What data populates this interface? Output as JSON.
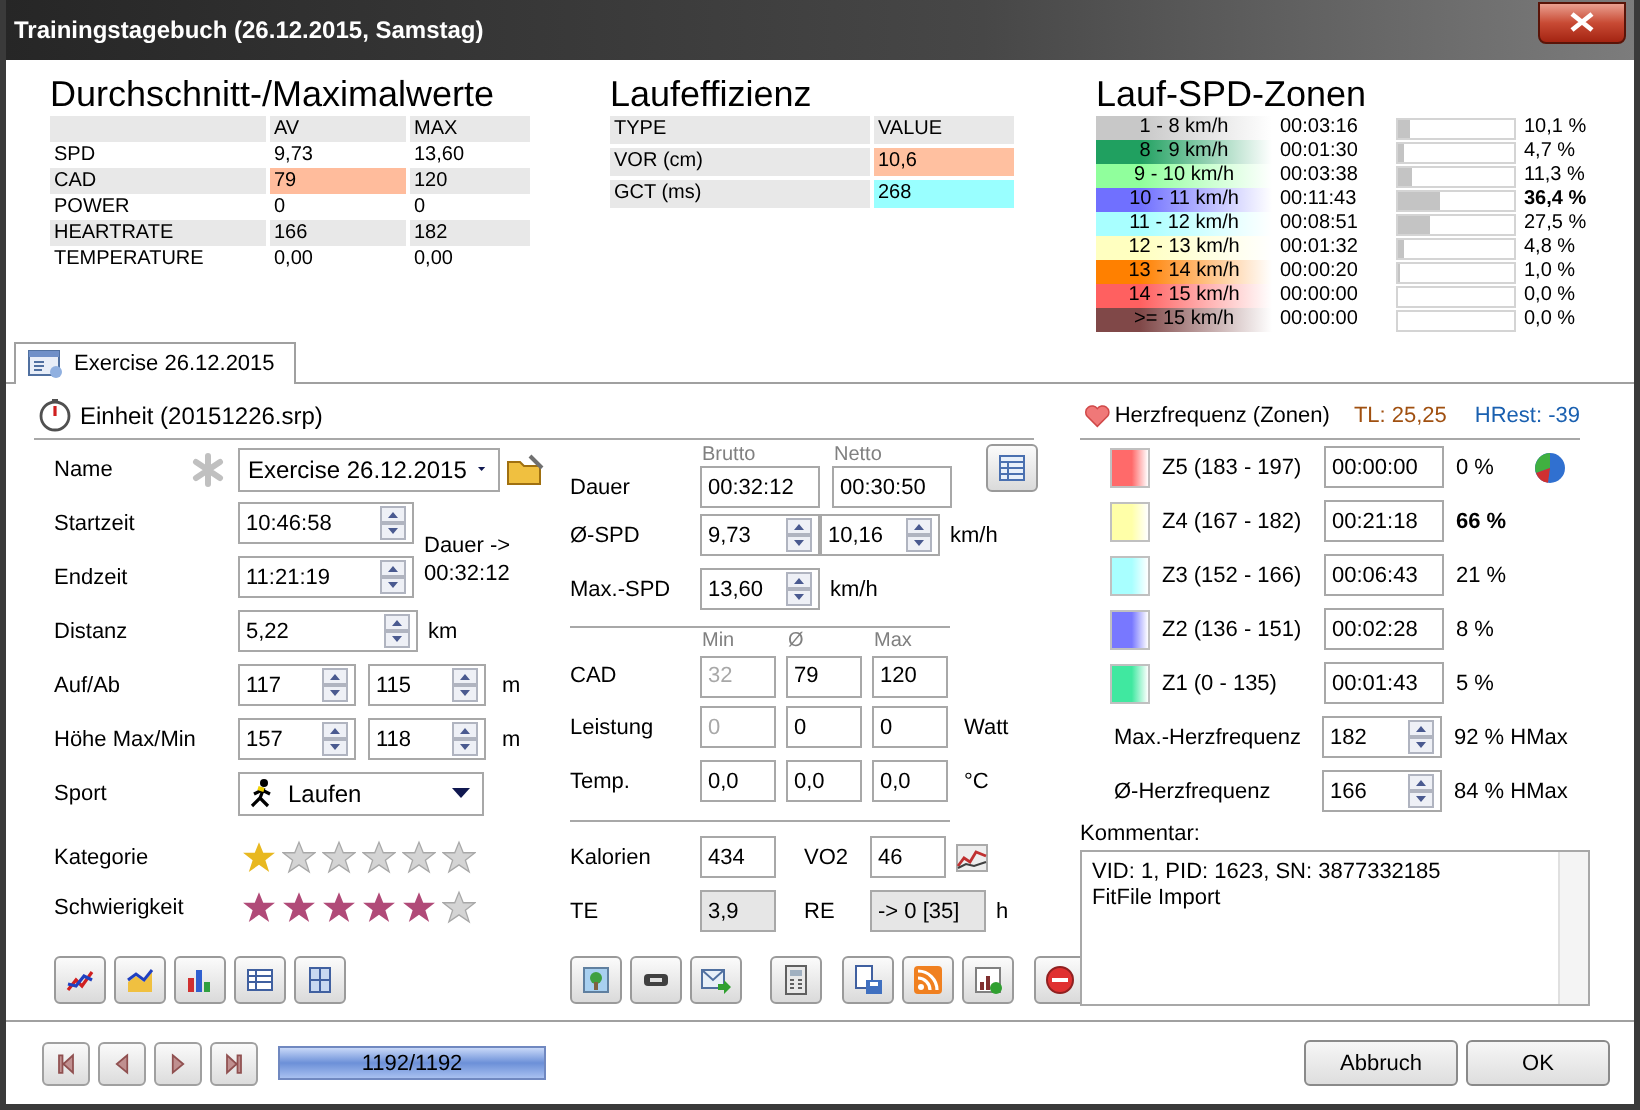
{
  "window": {
    "title": "Trainingstagebuch (26.12.2015, Samstag)"
  },
  "averages": {
    "title": "Durchschnitt-/Maximalwerte",
    "columns": [
      "AV",
      "MAX"
    ],
    "rows": [
      {
        "label": "SPD",
        "av": "9,73",
        "max": "13,60",
        "highlight": false
      },
      {
        "label": "CAD",
        "av": "79",
        "max": "120",
        "highlight": true
      },
      {
        "label": "POWER",
        "av": "0",
        "max": "0",
        "highlight": false
      },
      {
        "label": "HEARTRATE",
        "av": "166",
        "max": "182",
        "highlight": false
      },
      {
        "label": "TEMPERATURE",
        "av": "0,00",
        "max": "0,00",
        "highlight": false
      }
    ]
  },
  "efficiency": {
    "title": "Laufeffizienz",
    "columns": [
      "TYPE",
      "VALUE"
    ],
    "rows": [
      {
        "type": "VOR (cm)",
        "value": "10,6",
        "color": "#ffc0a0"
      },
      {
        "type": "GCT (ms)",
        "value": "268",
        "color": "#99ffff"
      }
    ]
  },
  "speed_zones": {
    "title": "Lauf-SPD-Zonen",
    "rows": [
      {
        "label": "1 - 8 km/h",
        "time": "00:03:16",
        "percent": "10,1 %",
        "level": 0.101,
        "color": "#c8c8c8",
        "emphasis": false
      },
      {
        "label": "8 - 9 km/h",
        "time": "00:01:30",
        "percent": "4,7 %",
        "level": 0.047,
        "color": "#20a060",
        "emphasis": false
      },
      {
        "label": "9 - 10 km/h",
        "time": "00:03:38",
        "percent": "11,3 %",
        "level": 0.113,
        "color": "#90ff9c",
        "emphasis": false
      },
      {
        "label": "10 - 11 km/h",
        "time": "00:11:43",
        "percent": "36,4 %",
        "level": 0.364,
        "color": "#7070ff",
        "emphasis": true
      },
      {
        "label": "11 - 12 km/h",
        "time": "00:08:51",
        "percent": "27,5 %",
        "level": 0.275,
        "color": "#a8ffff",
        "emphasis": false
      },
      {
        "label": "12 - 13 km/h",
        "time": "00:01:32",
        "percent": "4,8 %",
        "level": 0.048,
        "color": "#ffffc0",
        "emphasis": false
      },
      {
        "label": "13 - 14 km/h",
        "time": "00:00:20",
        "percent": "1,0 %",
        "level": 0.01,
        "color": "#ff8000",
        "emphasis": false
      },
      {
        "label": "14 - 15 km/h",
        "time": "00:00:00",
        "percent": "0,0 %",
        "color": "#ff6060",
        "emphasis": false
      },
      {
        "label": ">= 15 km/h",
        "time": "00:00:00",
        "percent": "0,0 %",
        "color": "#804848",
        "emphasis": false
      }
    ]
  },
  "tabs": [
    {
      "label": "Exercise 26.12.2015",
      "selected": true
    }
  ],
  "unit": {
    "title": "Einheit (20151226.srp)"
  },
  "left": {
    "name": {
      "label": "Name",
      "value": "Exercise 26.12.2015"
    },
    "start": {
      "label": "Startzeit",
      "value": "10:46:58"
    },
    "end": {
      "label": "Endzeit",
      "value": "11:21:19"
    },
    "duration_note": {
      "label": "Dauer ->",
      "value": "00:32:12"
    },
    "distance": {
      "label": "Distanz",
      "value": "5,22",
      "unit": "km"
    },
    "pairs": [
      {
        "label": "Auf/Ab",
        "values": [
          "117",
          "115"
        ],
        "unit": "m"
      },
      {
        "label": "Höhe Max/Min",
        "values": [
          "157",
          "118"
        ],
        "unit": "m"
      }
    ],
    "sport": {
      "label": "Sport",
      "value": "Laufen"
    },
    "ratings": [
      {
        "label": "Kategorie",
        "stars": 1,
        "color": "#e8b820"
      },
      {
        "label": "Schwierigkeit",
        "stars": 5,
        "color": "#b04a78"
      }
    ]
  },
  "middle": {
    "duration": {
      "label": "Dauer",
      "headers": [
        "Brutto",
        "Netto"
      ],
      "values": [
        "00:32:12",
        "00:30:50"
      ]
    },
    "avg_speed": {
      "label": "Ø-SPD",
      "values": [
        "9,73",
        "10,16"
      ],
      "unit": "km/h"
    },
    "max_speed": {
      "label": "Max.-SPD",
      "value": "13,60",
      "unit": "km/h"
    },
    "stats_headers": [
      "Min",
      "Ø",
      "Max"
    ],
    "stats": [
      {
        "label": "CAD",
        "cells": [
          {
            "value": "32",
            "disabled": true
          },
          {
            "value": "79",
            "disabled": false
          },
          {
            "value": "120",
            "disabled": false
          }
        ]
      },
      {
        "label": "Leistung",
        "unit": "Watt",
        "cells": [
          {
            "value": "0",
            "disabled": true
          },
          {
            "value": "0",
            "disabled": false
          },
          {
            "value": "0",
            "disabled": false
          }
        ]
      },
      {
        "label": "Temp.",
        "unit": "°C",
        "cells": [
          {
            "value": "0,0",
            "disabled": false
          },
          {
            "value": "0,0",
            "disabled": false
          },
          {
            "value": "0,0",
            "disabled": false
          }
        ]
      }
    ],
    "calories": {
      "label": "Kalorien",
      "value": "434"
    },
    "vo2": {
      "label": "VO2",
      "value": "46"
    },
    "te": {
      "label": "TE",
      "value": "3,9"
    },
    "re": {
      "label": "RE",
      "value": "-> 0 [35]",
      "unit": "h"
    }
  },
  "heart": {
    "title": "Herzfrequenz (Zonen)",
    "tl": "TL: 25,25",
    "hrest": "HRest: -39",
    "zones": [
      {
        "label": "Z5 (183 - 197)",
        "time": "00:00:00",
        "percent": "0 %",
        "color": "#ff6a6a",
        "emphasis": false
      },
      {
        "label": "Z4 (167 - 182)",
        "time": "00:21:18",
        "percent": "66 %",
        "color": "#ffffa8",
        "emphasis": true
      },
      {
        "label": "Z3 (152 - 166)",
        "time": "00:06:43",
        "percent": "21 %",
        "color": "#a8ffff",
        "emphasis": false
      },
      {
        "label": "Z2 (136 - 151)",
        "time": "00:02:28",
        "percent": "8 %",
        "color": "#7878ff",
        "emphasis": false
      },
      {
        "label": "Z1 (0 - 135)",
        "time": "00:01:43",
        "percent": "5 %",
        "color": "#40e8a0",
        "emphasis": false
      }
    ],
    "max": {
      "label": "Max.-Herzfrequenz",
      "value": "182",
      "note": "92 % HMax"
    },
    "avg": {
      "label": "Ø-Herzfrequenz",
      "value": "166",
      "note": "84 % HMax"
    }
  },
  "comment": {
    "label": "Kommentar:",
    "lines": [
      "VID: 1, PID: 1623, SN: 3877332185",
      "FitFile Import"
    ]
  },
  "footer": {
    "progress": {
      "label": "1192/1192",
      "level": 1.0
    },
    "buttons": [
      "Abbruch",
      "OK"
    ]
  }
}
